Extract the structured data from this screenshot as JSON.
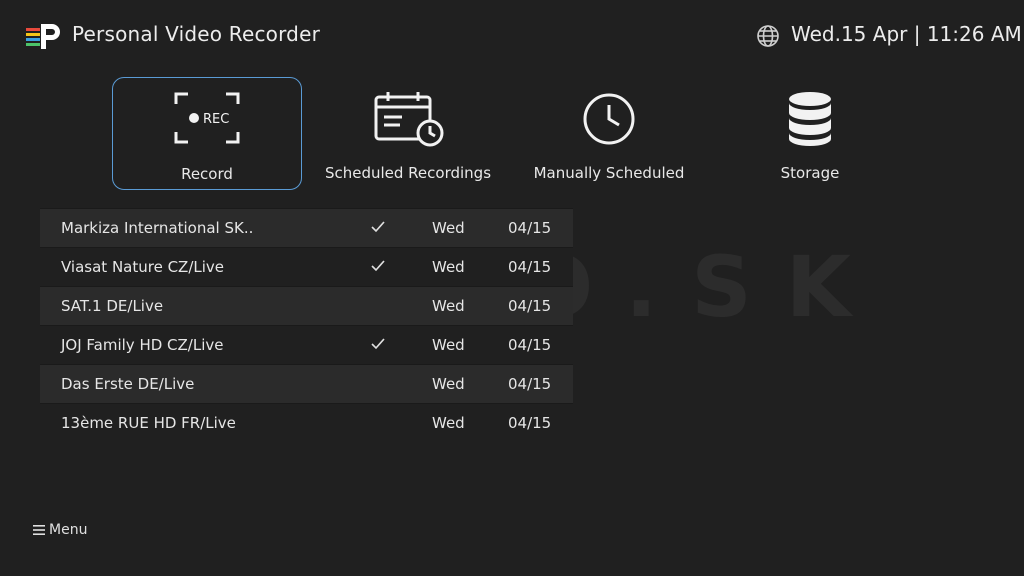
{
  "header": {
    "title": "Personal Video Recorder",
    "datetime": "Wed.15 Apr | 11:26 AM"
  },
  "watermark": "ELLANO.SK",
  "tabs": [
    {
      "label": "Record",
      "icon": "rec-icon",
      "active": true
    },
    {
      "label": "Scheduled Recordings",
      "icon": "calendar-clock-icon",
      "active": false
    },
    {
      "label": "Manually Scheduled",
      "icon": "clock-icon",
      "active": false
    },
    {
      "label": "Storage",
      "icon": "database-icon",
      "active": false
    }
  ],
  "rec_icon_text": "REC",
  "recordings": [
    {
      "name": "Markiza International SK..",
      "checked": true,
      "day": "Wed",
      "date": "04/15"
    },
    {
      "name": "Viasat Nature CZ/Live",
      "checked": true,
      "day": "Wed",
      "date": "04/15"
    },
    {
      "name": "SAT.1 DE/Live",
      "checked": false,
      "day": "Wed",
      "date": "04/15"
    },
    {
      "name": "JOJ Family HD CZ/Live",
      "checked": true,
      "day": "Wed",
      "date": "04/15"
    },
    {
      "name": "Das Erste DE/Live",
      "checked": false,
      "day": "Wed",
      "date": "04/15"
    },
    {
      "name": "13ème RUE HD FR/Live",
      "checked": false,
      "day": "Wed",
      "date": "04/15"
    }
  ],
  "footer": {
    "menu_label": "Menu"
  },
  "colors": {
    "accent": "#5a9bd5",
    "background": "#202020",
    "row_alt": "#2b2b2b"
  }
}
